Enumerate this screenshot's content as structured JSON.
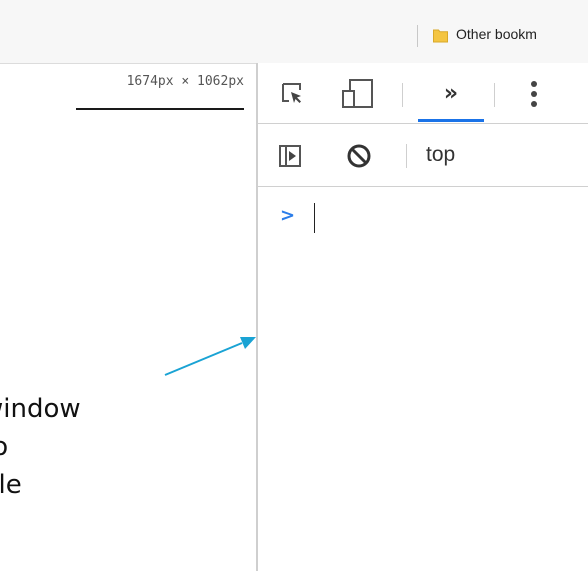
{
  "bookmarks": {
    "other_label": "Other bookm"
  },
  "page": {
    "dimensions": "1674px × 1062px"
  },
  "devtools": {
    "more_tabs_label": "»",
    "context": "top",
    "prompt_symbol": ">"
  },
  "annotation": {
    "lines": [
      "window",
      "to",
      "ble"
    ]
  },
  "colors": {
    "accent": "#1a73e8",
    "arrow": "#1aa3d4",
    "prompt": "#2b7de9",
    "folder": "#f4c542"
  }
}
